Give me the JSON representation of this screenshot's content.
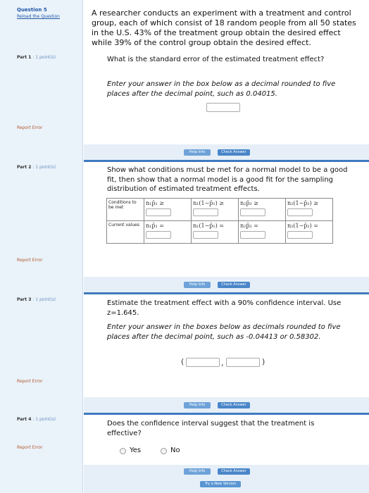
{
  "question": {
    "title": "Question 5",
    "reload": "Reload the Question",
    "stem": "A researcher conducts an experiment with a treatment and control group, each of which consist of 18 random people from all 50 states in the U.S. 43% of the treatment group obtain the desired effect while 39% of the control group obtain the desired effect."
  },
  "report_error": "Report Error",
  "help_label": "Help Info",
  "check_label": "Check Answer",
  "try_label": "Try a New Version",
  "parts": [
    {
      "label": "Part 1",
      "points": ": 1 point(s)",
      "question": "What is the standard error of the estimated treatment effect?",
      "instruction": "Enter your answer in the box below as a decimal rounded to five places after the decimal point, such as 0.04015."
    },
    {
      "label": "Part 2",
      "points": ": 1 point(s)",
      "question": "Show what conditions must be met for a normal model to be a good fit, then show that a normal model is a good fit for the sampling distribution of estimated treatment effects.",
      "table": {
        "row1_label": "Conditions to be met",
        "row2_label": "Current values",
        "row1": [
          "n₁p̄₁ ≥",
          "n₁(1−p̄₁) ≥",
          "n₂p̄₂ ≥",
          "n₂(1−p̄₂) ≥"
        ],
        "row2": [
          "n₁p̄₁ =",
          "n₁(1−p̄₁) =",
          "n₂p̄₂ =",
          "n₂(1−p̄₂) ="
        ]
      }
    },
    {
      "label": "Part 3",
      "points": ": 1 point(s)",
      "question": "Estimate the treatment effect with a 90% confidence interval. Use z=1.645.",
      "instruction": "Enter your answer in the boxes below as decimals rounded to five places after the decimal point, such as -0.04413 or 0.58302.",
      "open_paren": "(",
      "comma": ",",
      "close_paren": ")"
    },
    {
      "label": "Part 4",
      "points": ": 1 point(s)",
      "question": "Does the confidence interval suggest that the treatment is effective?",
      "options": [
        "Yes",
        "No"
      ]
    }
  ]
}
